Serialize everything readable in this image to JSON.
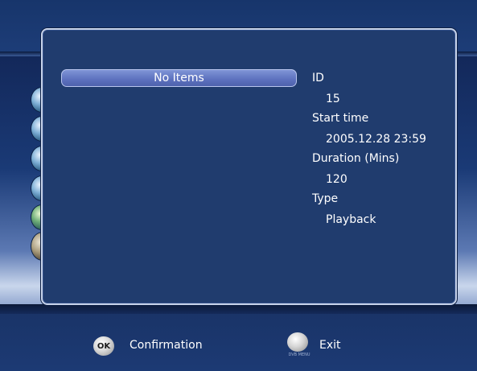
{
  "list": {
    "items": [
      "No Items"
    ]
  },
  "details": {
    "id_label": "ID",
    "id_value": "15",
    "start_time_label": "Start time",
    "start_time_value": "2005.12.28 23:59",
    "duration_label": "Duration (Mins)",
    "duration_value": "120",
    "type_label": "Type",
    "type_value": "Playback"
  },
  "footer": {
    "ok_key": "OK",
    "confirm_label": "Confirmation",
    "exit_sub": "DVB MENU",
    "exit_label": "Exit"
  },
  "icons": {
    "ok": "ok-button-icon",
    "exit": "exit-button-icon",
    "side": "menu-orb-icon"
  },
  "colors": {
    "panel_bg": "#203c6e",
    "panel_border": "#c7d3ea",
    "highlight": "#6377c4"
  }
}
